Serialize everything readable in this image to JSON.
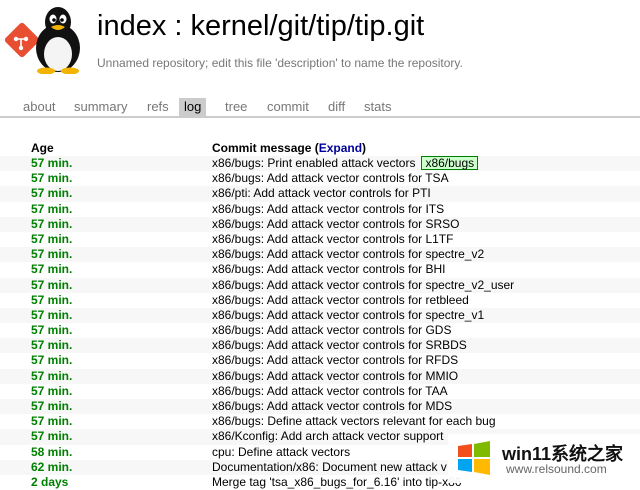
{
  "header": {
    "title": "index : kernel/git/tip/tip.git",
    "description": "Unnamed repository; edit this file 'description' to name the repository."
  },
  "tabs": [
    {
      "label": "about",
      "active": false
    },
    {
      "label": "summary",
      "active": false
    },
    {
      "label": "refs",
      "active": false
    },
    {
      "label": "log",
      "active": true
    },
    {
      "label": "tree",
      "active": false
    },
    {
      "label": "commit",
      "active": false
    },
    {
      "label": "diff",
      "active": false
    },
    {
      "label": "stats",
      "active": false
    }
  ],
  "log": {
    "age_header": "Age",
    "message_header_prefix": "Commit message (",
    "expand_label": "Expand",
    "message_header_suffix": ")",
    "rows": [
      {
        "age": "57 min.",
        "message": "x86/bugs: Print enabled attack vectors",
        "decoration": "x86/bugs"
      },
      {
        "age": "57 min.",
        "message": "x86/bugs: Add attack vector controls for TSA"
      },
      {
        "age": "57 min.",
        "message": "x86/pti: Add attack vector controls for PTI"
      },
      {
        "age": "57 min.",
        "message": "x86/bugs: Add attack vector controls for ITS"
      },
      {
        "age": "57 min.",
        "message": "x86/bugs: Add attack vector controls for SRSO"
      },
      {
        "age": "57 min.",
        "message": "x86/bugs: Add attack vector controls for L1TF"
      },
      {
        "age": "57 min.",
        "message": "x86/bugs: Add attack vector controls for spectre_v2"
      },
      {
        "age": "57 min.",
        "message": "x86/bugs: Add attack vector controls for BHI"
      },
      {
        "age": "57 min.",
        "message": "x86/bugs: Add attack vector controls for spectre_v2_user"
      },
      {
        "age": "57 min.",
        "message": "x86/bugs: Add attack vector controls for retbleed"
      },
      {
        "age": "57 min.",
        "message": "x86/bugs: Add attack vector controls for spectre_v1"
      },
      {
        "age": "57 min.",
        "message": "x86/bugs: Add attack vector controls for GDS"
      },
      {
        "age": "57 min.",
        "message": "x86/bugs: Add attack vector controls for SRBDS"
      },
      {
        "age": "57 min.",
        "message": "x86/bugs: Add attack vector controls for RFDS"
      },
      {
        "age": "57 min.",
        "message": "x86/bugs: Add attack vector controls for MMIO"
      },
      {
        "age": "57 min.",
        "message": "x86/bugs: Add attack vector controls for TAA"
      },
      {
        "age": "57 min.",
        "message": "x86/bugs: Add attack vector controls for MDS"
      },
      {
        "age": "57 min.",
        "message": "x86/bugs: Define attack vectors relevant for each bug"
      },
      {
        "age": "57 min.",
        "message": "x86/Kconfig: Add arch attack vector support"
      },
      {
        "age": "58 min.",
        "message": "cpu: Define attack vectors"
      },
      {
        "age": "62 min.",
        "message": "Documentation/x86: Document new attack v"
      },
      {
        "age": "2 days",
        "message": "Merge tag 'tsa_x86_bugs_for_6.16' into tip-x86"
      }
    ]
  },
  "watermark": {
    "text": "win11系统之家",
    "url": "www.relsound.com"
  },
  "colors": {
    "age_green": "#008000",
    "tab_active_bg": "#cccccc",
    "decoration_bg": "#ccffcc",
    "expand_link": "#000099"
  }
}
